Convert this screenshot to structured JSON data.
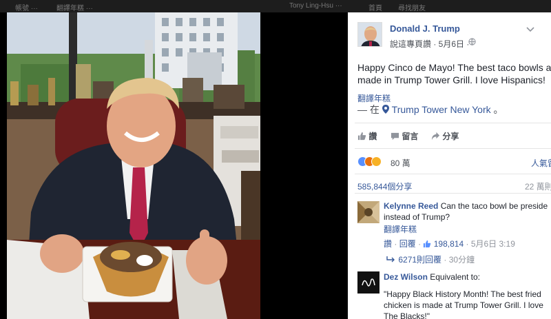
{
  "topbar": {
    "items": [
      "帳號 ···",
      "翻譯年糕 ···",
      "Tony Ling-Hsu ···",
      "首頁",
      "尋找朋友"
    ]
  },
  "post": {
    "author": "Donald J. Trump",
    "author_meta": "說這專頁讚 · 5月6日 ·",
    "globe_icon": "globe-icon",
    "text_line1": "Happy Cinco de Mayo! The best taco bowls ar",
    "text_line2": "made in Trump Tower Grill. I love Hispanics!",
    "translate": "翻譯年糕",
    "location_prefix": "— 在",
    "location": "Trump Tower New York",
    "location_suffix": "。",
    "actions": {
      "like": "讚",
      "comment": "留言",
      "share": "分享"
    },
    "reactions_count": "80 萬",
    "reactions_right": "人氣留",
    "shares": "585,844個分享",
    "views_right": "22 萬則"
  },
  "comments": [
    {
      "name": "Kelynne Reed",
      "text_line1": "Can the taco bowl be preside",
      "text_line2": "instead of Trump?",
      "translate": "翻譯年糕",
      "like": "讚",
      "reply": "回覆",
      "likes_count": "198,814",
      "timestamp": "5月6日 3:19",
      "replies_link": "6271則回覆",
      "replies_time": "· 30分鐘"
    },
    {
      "name": "Dez Wilson",
      "text_line1": "Equivalent to:",
      "quote_line1": "\"Happy Black History Month! The best fried",
      "quote_line2": "chicken is made at Trump Tower Grill. I love",
      "quote_line3": "The Blacks!\""
    }
  ],
  "colors": {
    "link": "#365899",
    "meta": "#90949c",
    "like_blue": "#5890ff",
    "text": "#1d2129"
  }
}
